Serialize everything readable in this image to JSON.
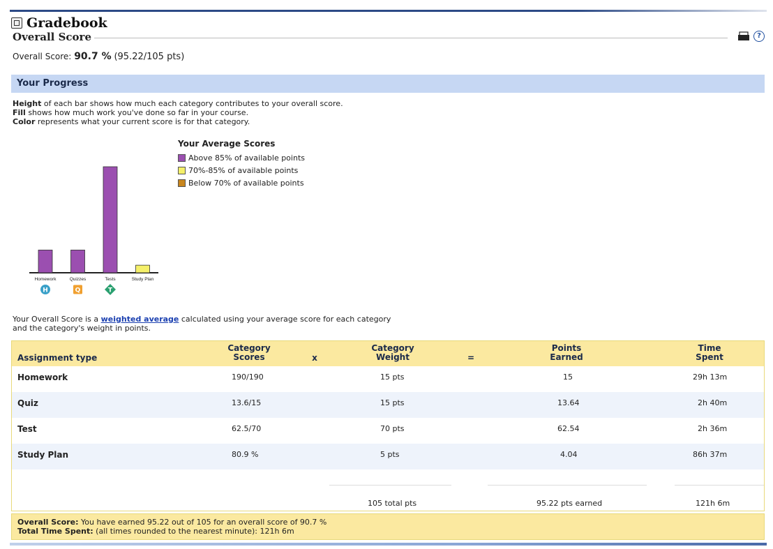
{
  "app": {
    "title": "Gradebook"
  },
  "section": {
    "heading": "Overall Score"
  },
  "overall": {
    "label": "Overall Score:",
    "percent": "90.7 %",
    "points": "(95.22/105 pts)"
  },
  "progress": {
    "heading": "Your Progress",
    "line1_bold": "Height",
    "line1_rest": " of each bar shows how much each category contributes to your overall score.",
    "line2_bold": "Fill",
    "line2_rest": " shows how much work you've done so far in your course.",
    "line3_bold": "Color",
    "line3_rest": " represents what your current score is for that category."
  },
  "legend": {
    "title": "Your Average Scores",
    "items": [
      {
        "label": "Above 85% of available points",
        "color": "#9b4fb0"
      },
      {
        "label": "70%-85% of available points",
        "color": "#f5f06a"
      },
      {
        "label": "Below 70% of available points",
        "color": "#c8861e"
      }
    ]
  },
  "chart_data": {
    "type": "bar",
    "categories": [
      "Homework",
      "Quizzes",
      "Tests",
      "Study Plan"
    ],
    "values": [
      15,
      15,
      70,
      5
    ],
    "fill": [
      1.0,
      1.0,
      1.0,
      1.0
    ],
    "colors": [
      "#9b4fb0",
      "#9b4fb0",
      "#9b4fb0",
      "#f5f06a"
    ],
    "badges": [
      {
        "letter": "H",
        "color": "#3aa0c8",
        "shape": "circle"
      },
      {
        "letter": "Q",
        "color": "#f0a030",
        "shape": "square"
      },
      {
        "letter": "T",
        "color": "#2aa070",
        "shape": "diamond"
      },
      {
        "letter": "",
        "color": "",
        "shape": "none"
      }
    ],
    "ylim": [
      0,
      70
    ]
  },
  "note": {
    "pre": "Your Overall Score is a ",
    "link": "weighted average",
    "post": " calculated using your average score for each category",
    "line2": "and the category's weight in points."
  },
  "table": {
    "headers": {
      "type": "Assignment type",
      "scores_1": "Category",
      "scores_2": "Scores",
      "times": "x",
      "weight_1": "Category",
      "weight_2": "Weight",
      "equals": "=",
      "earned_1": "Points",
      "earned_2": "Earned",
      "time_1": "Time",
      "time_2": "Spent"
    },
    "rows": [
      {
        "type": "Homework",
        "score": "190/190",
        "weight": "15 pts",
        "earned": "15",
        "time": "29h 13m"
      },
      {
        "type": "Quiz",
        "score": "13.6/15",
        "weight": "15 pts",
        "earned": "13.64",
        "time": "2h 40m"
      },
      {
        "type": "Test",
        "score": "62.5/70",
        "weight": "70 pts",
        "earned": "62.54",
        "time": "2h 36m"
      },
      {
        "type": "Study Plan",
        "score": "80.9 %",
        "weight": "5 pts",
        "earned": "4.04",
        "time": "86h 37m"
      }
    ],
    "totals": {
      "weight": "105 total pts",
      "earned": "95.22 pts earned",
      "time": "121h 6m"
    }
  },
  "footer": {
    "score_label": "Overall Score:",
    "score_text": " You have earned 95.22 out of 105 for an overall score of 90.7 %",
    "time_label": "Total Time Spent:",
    "time_text": " (all times rounded to the nearest minute): 121h 6m"
  }
}
